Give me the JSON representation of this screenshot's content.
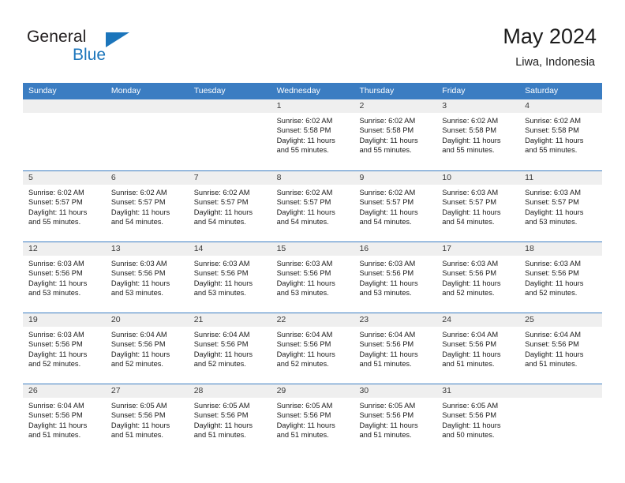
{
  "brand": {
    "name_part1": "General",
    "name_part2": "Blue",
    "triangle_color": "#1b75bb"
  },
  "header": {
    "title": "May 2024",
    "subtitle": "Liwa, Indonesia"
  },
  "theme": {
    "header_blue": "#3b7dc2",
    "day_band_gray": "#efefef",
    "text_color": "#1a1a1a"
  },
  "weekdays": [
    "Sunday",
    "Monday",
    "Tuesday",
    "Wednesday",
    "Thursday",
    "Friday",
    "Saturday"
  ],
  "weeks": [
    [
      {
        "day": "",
        "sunrise": "",
        "sunset": "",
        "daylight_line1": "",
        "daylight_line2": ""
      },
      {
        "day": "",
        "sunrise": "",
        "sunset": "",
        "daylight_line1": "",
        "daylight_line2": ""
      },
      {
        "day": "",
        "sunrise": "",
        "sunset": "",
        "daylight_line1": "",
        "daylight_line2": ""
      },
      {
        "day": "1",
        "sunrise": "Sunrise: 6:02 AM",
        "sunset": "Sunset: 5:58 PM",
        "daylight_line1": "Daylight: 11 hours",
        "daylight_line2": "and 55 minutes."
      },
      {
        "day": "2",
        "sunrise": "Sunrise: 6:02 AM",
        "sunset": "Sunset: 5:58 PM",
        "daylight_line1": "Daylight: 11 hours",
        "daylight_line2": "and 55 minutes."
      },
      {
        "day": "3",
        "sunrise": "Sunrise: 6:02 AM",
        "sunset": "Sunset: 5:58 PM",
        "daylight_line1": "Daylight: 11 hours",
        "daylight_line2": "and 55 minutes."
      },
      {
        "day": "4",
        "sunrise": "Sunrise: 6:02 AM",
        "sunset": "Sunset: 5:58 PM",
        "daylight_line1": "Daylight: 11 hours",
        "daylight_line2": "and 55 minutes."
      }
    ],
    [
      {
        "day": "5",
        "sunrise": "Sunrise: 6:02 AM",
        "sunset": "Sunset: 5:57 PM",
        "daylight_line1": "Daylight: 11 hours",
        "daylight_line2": "and 55 minutes."
      },
      {
        "day": "6",
        "sunrise": "Sunrise: 6:02 AM",
        "sunset": "Sunset: 5:57 PM",
        "daylight_line1": "Daylight: 11 hours",
        "daylight_line2": "and 54 minutes."
      },
      {
        "day": "7",
        "sunrise": "Sunrise: 6:02 AM",
        "sunset": "Sunset: 5:57 PM",
        "daylight_line1": "Daylight: 11 hours",
        "daylight_line2": "and 54 minutes."
      },
      {
        "day": "8",
        "sunrise": "Sunrise: 6:02 AM",
        "sunset": "Sunset: 5:57 PM",
        "daylight_line1": "Daylight: 11 hours",
        "daylight_line2": "and 54 minutes."
      },
      {
        "day": "9",
        "sunrise": "Sunrise: 6:02 AM",
        "sunset": "Sunset: 5:57 PM",
        "daylight_line1": "Daylight: 11 hours",
        "daylight_line2": "and 54 minutes."
      },
      {
        "day": "10",
        "sunrise": "Sunrise: 6:03 AM",
        "sunset": "Sunset: 5:57 PM",
        "daylight_line1": "Daylight: 11 hours",
        "daylight_line2": "and 54 minutes."
      },
      {
        "day": "11",
        "sunrise": "Sunrise: 6:03 AM",
        "sunset": "Sunset: 5:57 PM",
        "daylight_line1": "Daylight: 11 hours",
        "daylight_line2": "and 53 minutes."
      }
    ],
    [
      {
        "day": "12",
        "sunrise": "Sunrise: 6:03 AM",
        "sunset": "Sunset: 5:56 PM",
        "daylight_line1": "Daylight: 11 hours",
        "daylight_line2": "and 53 minutes."
      },
      {
        "day": "13",
        "sunrise": "Sunrise: 6:03 AM",
        "sunset": "Sunset: 5:56 PM",
        "daylight_line1": "Daylight: 11 hours",
        "daylight_line2": "and 53 minutes."
      },
      {
        "day": "14",
        "sunrise": "Sunrise: 6:03 AM",
        "sunset": "Sunset: 5:56 PM",
        "daylight_line1": "Daylight: 11 hours",
        "daylight_line2": "and 53 minutes."
      },
      {
        "day": "15",
        "sunrise": "Sunrise: 6:03 AM",
        "sunset": "Sunset: 5:56 PM",
        "daylight_line1": "Daylight: 11 hours",
        "daylight_line2": "and 53 minutes."
      },
      {
        "day": "16",
        "sunrise": "Sunrise: 6:03 AM",
        "sunset": "Sunset: 5:56 PM",
        "daylight_line1": "Daylight: 11 hours",
        "daylight_line2": "and 53 minutes."
      },
      {
        "day": "17",
        "sunrise": "Sunrise: 6:03 AM",
        "sunset": "Sunset: 5:56 PM",
        "daylight_line1": "Daylight: 11 hours",
        "daylight_line2": "and 52 minutes."
      },
      {
        "day": "18",
        "sunrise": "Sunrise: 6:03 AM",
        "sunset": "Sunset: 5:56 PM",
        "daylight_line1": "Daylight: 11 hours",
        "daylight_line2": "and 52 minutes."
      }
    ],
    [
      {
        "day": "19",
        "sunrise": "Sunrise: 6:03 AM",
        "sunset": "Sunset: 5:56 PM",
        "daylight_line1": "Daylight: 11 hours",
        "daylight_line2": "and 52 minutes."
      },
      {
        "day": "20",
        "sunrise": "Sunrise: 6:04 AM",
        "sunset": "Sunset: 5:56 PM",
        "daylight_line1": "Daylight: 11 hours",
        "daylight_line2": "and 52 minutes."
      },
      {
        "day": "21",
        "sunrise": "Sunrise: 6:04 AM",
        "sunset": "Sunset: 5:56 PM",
        "daylight_line1": "Daylight: 11 hours",
        "daylight_line2": "and 52 minutes."
      },
      {
        "day": "22",
        "sunrise": "Sunrise: 6:04 AM",
        "sunset": "Sunset: 5:56 PM",
        "daylight_line1": "Daylight: 11 hours",
        "daylight_line2": "and 52 minutes."
      },
      {
        "day": "23",
        "sunrise": "Sunrise: 6:04 AM",
        "sunset": "Sunset: 5:56 PM",
        "daylight_line1": "Daylight: 11 hours",
        "daylight_line2": "and 51 minutes."
      },
      {
        "day": "24",
        "sunrise": "Sunrise: 6:04 AM",
        "sunset": "Sunset: 5:56 PM",
        "daylight_line1": "Daylight: 11 hours",
        "daylight_line2": "and 51 minutes."
      },
      {
        "day": "25",
        "sunrise": "Sunrise: 6:04 AM",
        "sunset": "Sunset: 5:56 PM",
        "daylight_line1": "Daylight: 11 hours",
        "daylight_line2": "and 51 minutes."
      }
    ],
    [
      {
        "day": "26",
        "sunrise": "Sunrise: 6:04 AM",
        "sunset": "Sunset: 5:56 PM",
        "daylight_line1": "Daylight: 11 hours",
        "daylight_line2": "and 51 minutes."
      },
      {
        "day": "27",
        "sunrise": "Sunrise: 6:05 AM",
        "sunset": "Sunset: 5:56 PM",
        "daylight_line1": "Daylight: 11 hours",
        "daylight_line2": "and 51 minutes."
      },
      {
        "day": "28",
        "sunrise": "Sunrise: 6:05 AM",
        "sunset": "Sunset: 5:56 PM",
        "daylight_line1": "Daylight: 11 hours",
        "daylight_line2": "and 51 minutes."
      },
      {
        "day": "29",
        "sunrise": "Sunrise: 6:05 AM",
        "sunset": "Sunset: 5:56 PM",
        "daylight_line1": "Daylight: 11 hours",
        "daylight_line2": "and 51 minutes."
      },
      {
        "day": "30",
        "sunrise": "Sunrise: 6:05 AM",
        "sunset": "Sunset: 5:56 PM",
        "daylight_line1": "Daylight: 11 hours",
        "daylight_line2": "and 51 minutes."
      },
      {
        "day": "31",
        "sunrise": "Sunrise: 6:05 AM",
        "sunset": "Sunset: 5:56 PM",
        "daylight_line1": "Daylight: 11 hours",
        "daylight_line2": "and 50 minutes."
      },
      {
        "day": "",
        "sunrise": "",
        "sunset": "",
        "daylight_line1": "",
        "daylight_line2": ""
      }
    ]
  ]
}
